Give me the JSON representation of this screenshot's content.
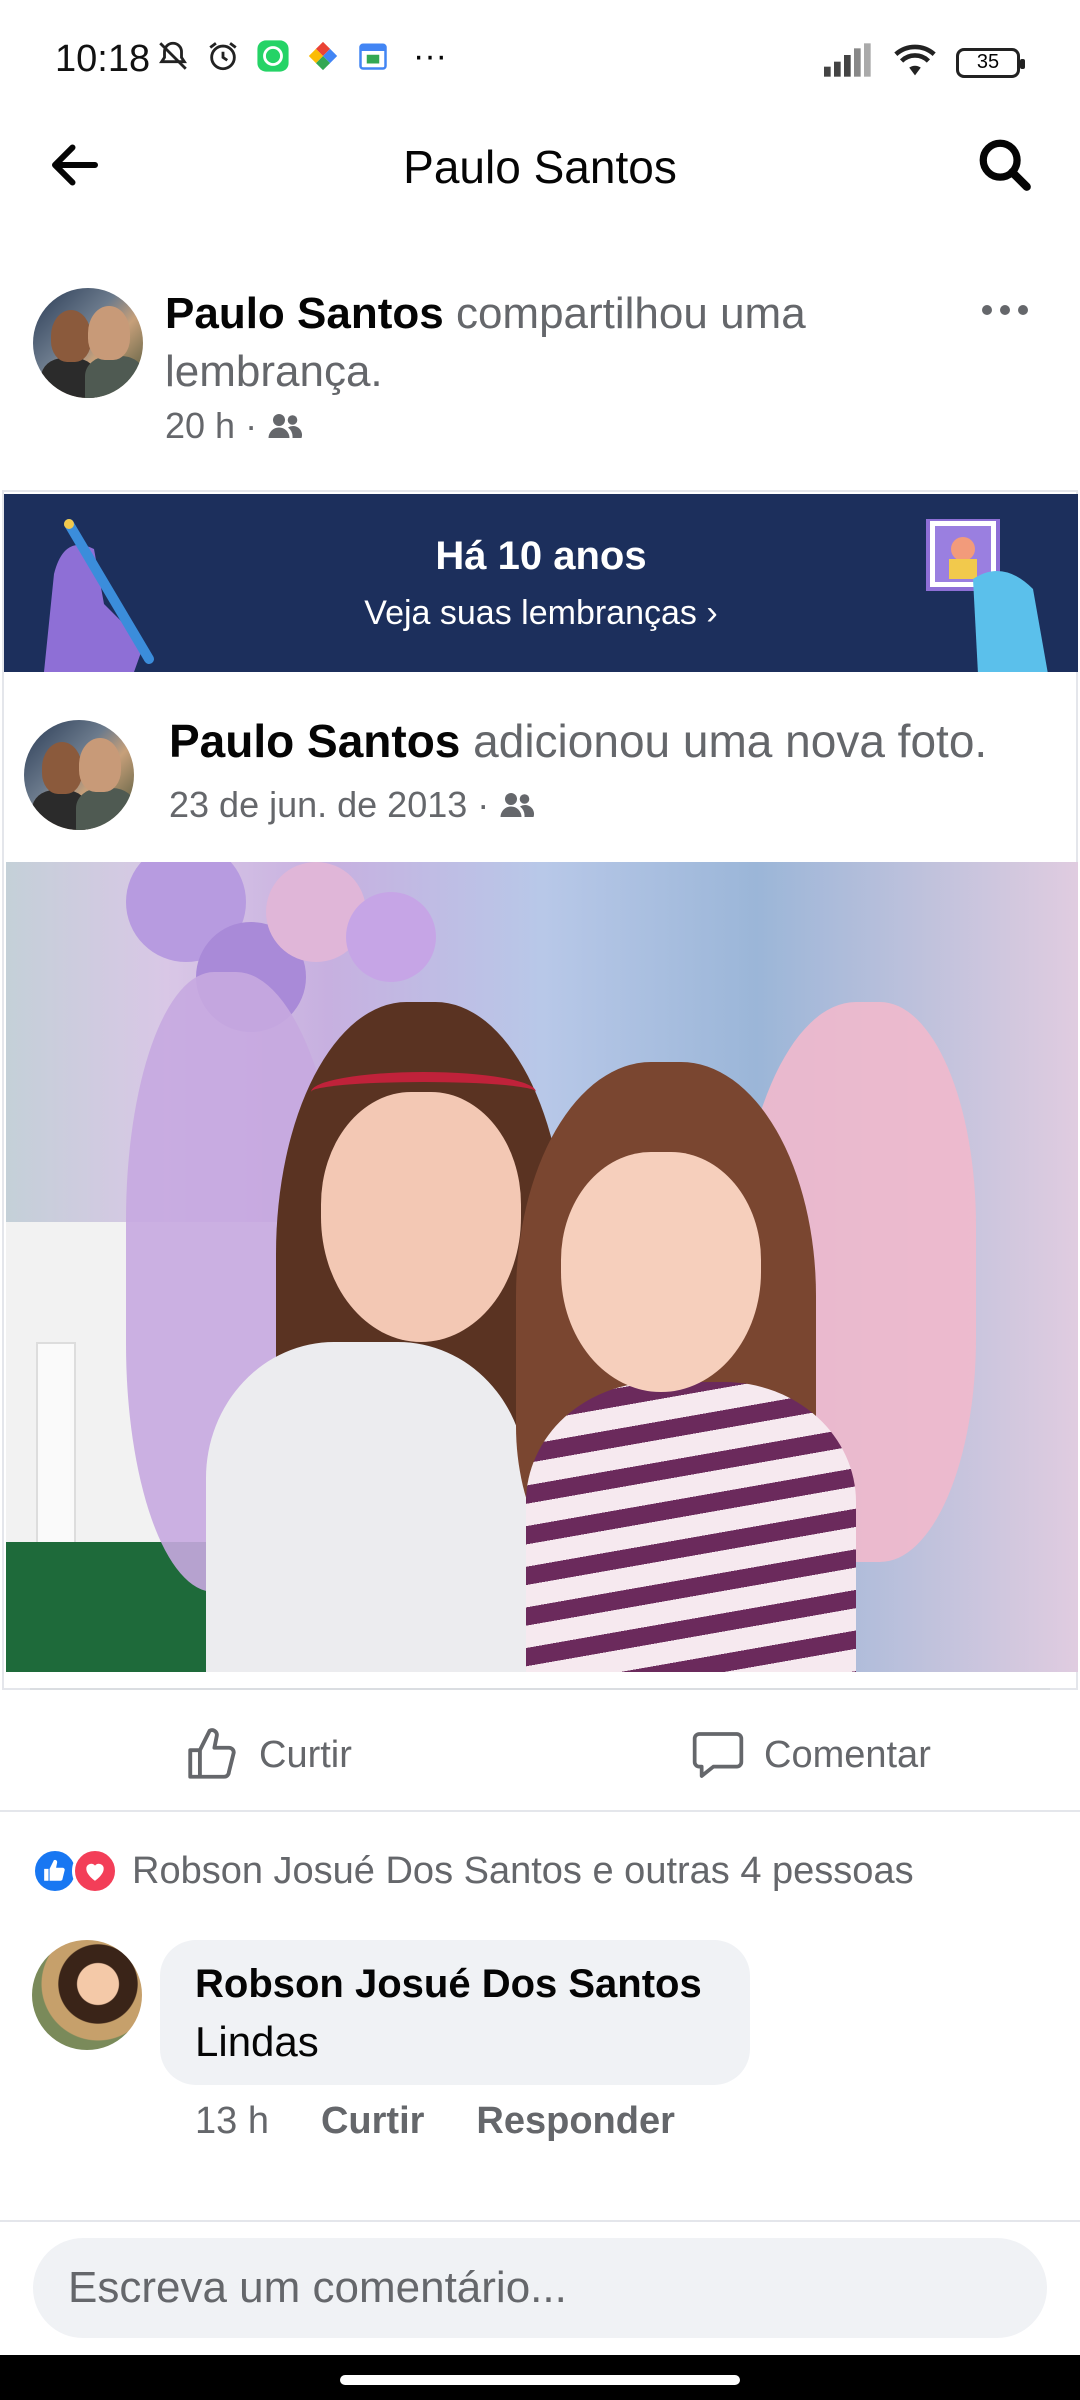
{
  "status_bar": {
    "time": "10:18",
    "battery": "35",
    "icons": [
      "mute-icon",
      "alarm-icon",
      "whatsapp-icon",
      "photos-app-icon",
      "calendar-icon",
      "more-icon",
      "signal-icon",
      "wifi-icon",
      "battery-icon"
    ],
    "more": "···"
  },
  "header": {
    "title": "Paulo Santos"
  },
  "share": {
    "author": "Paulo Santos",
    "action": " compartilhou uma lembrança.",
    "time": "20 h ·"
  },
  "memory": {
    "title": "Há 10 anos",
    "link": "Veja suas lembranças",
    "banner_color": "#1c2f5c"
  },
  "original_post": {
    "author": "Paulo Santos",
    "action": " adicionou uma nova foto.",
    "date": "23 de jun. de 2013 ·"
  },
  "actions": {
    "like": "Curtir",
    "comment": "Comentar"
  },
  "reactions": {
    "text": "Robson Josué Dos Santos e outras 4 pessoas",
    "like_color": "#1877f2",
    "love_color": "#f33e58"
  },
  "comment": {
    "author": "Robson Josué Dos Santos",
    "text": "Lindas",
    "time": "13 h",
    "like": "Curtir",
    "reply": "Responder"
  },
  "input": {
    "placeholder": "Escreva um comentário..."
  }
}
